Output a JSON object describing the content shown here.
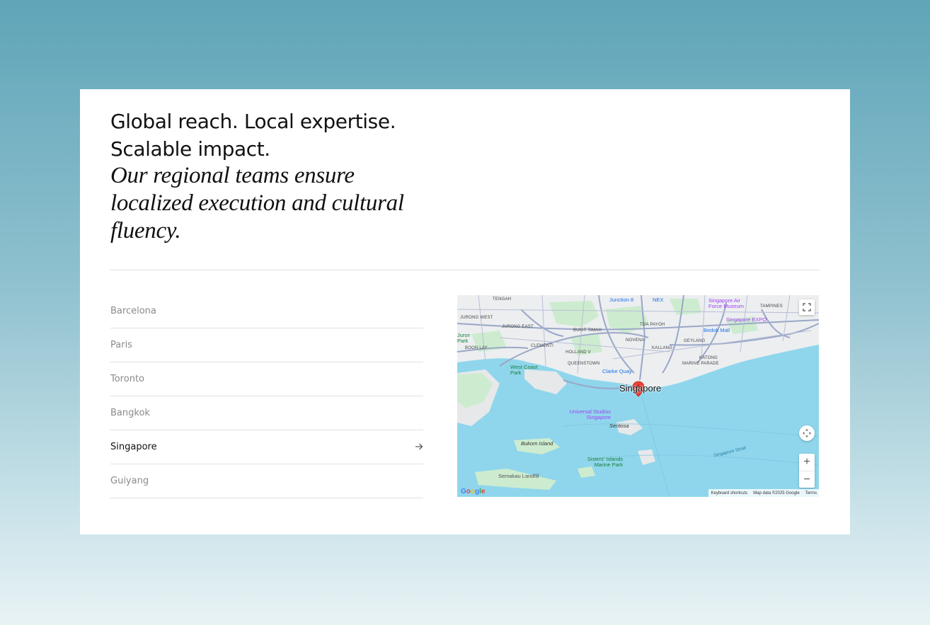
{
  "headline": "Global reach. Local expertise. Scalable impact.",
  "subheadline": "Our regional teams ensure localized execution and cultural fluency.",
  "cities": [
    {
      "name": "Barcelona",
      "active": false
    },
    {
      "name": "Paris",
      "active": false
    },
    {
      "name": "Toronto",
      "active": false
    },
    {
      "name": "Bangkok",
      "active": false
    },
    {
      "name": "Singapore",
      "active": true
    },
    {
      "name": "Guiyang",
      "active": false
    }
  ],
  "map": {
    "city_label": "Singapore",
    "areas": [
      "TENGAH",
      "JURONG WEST",
      "JURONG EAST",
      "BOON LAY",
      "CLEMENTI",
      "BUKIT TIMAH",
      "TOA PAYOH",
      "HOLLAND V",
      "NOVENA",
      "QUEENSTOWN",
      "KALLANG",
      "GEYLANG",
      "TAMPINES",
      "KATONG",
      "MARINE PARADE"
    ],
    "poi": {
      "junction8": "Junction 8",
      "nex": "NEX",
      "airforce": "Singapore Air Force Museum",
      "expo": "Singapore EXPO",
      "bedok": "Bedok Mall",
      "clarke": "Clarke Quay",
      "westcoast": "West Coast Park",
      "jurongpark": "Jurong Park",
      "universal": "Universal Studios Singapore",
      "sentosa": "Sentosa",
      "bukom": "Bukom Island",
      "sisters": "Sisters' Islands Marine Park",
      "semakau": "Semakau Landfill",
      "strait": "Singapore Strait"
    },
    "attribution": {
      "shortcuts": "Keyboard shortcuts",
      "data": "Map data ©2025 Google",
      "terms": "Terms"
    },
    "zoom_in": "+",
    "zoom_out": "−",
    "logo": "Google"
  }
}
